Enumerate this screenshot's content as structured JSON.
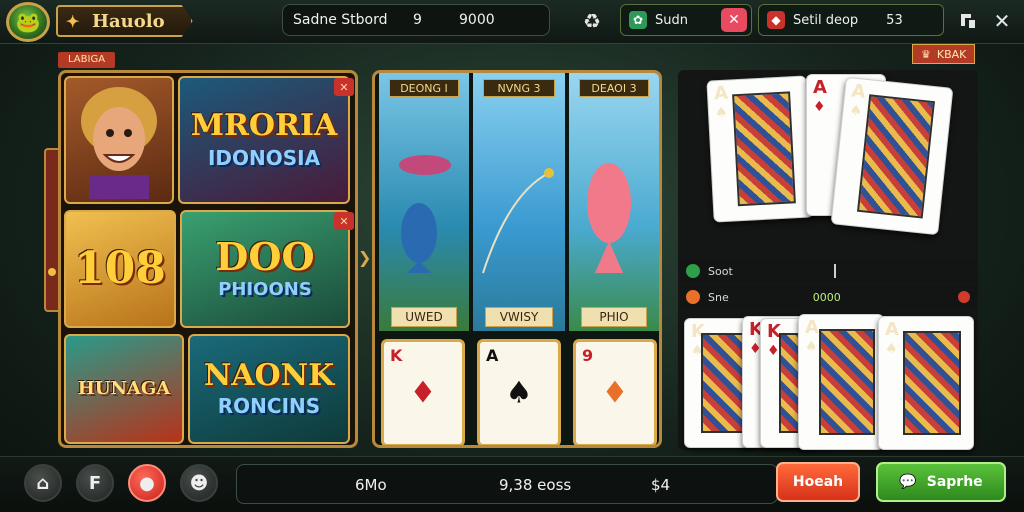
{
  "header": {
    "logo_icon": "frog-mascot-icon",
    "title": "Hauolo",
    "info_left": "Sadne Stbord",
    "info_mid": "9",
    "info_right": "9000",
    "recycle_icon": "recycle-icon",
    "pill1_label": "Sudn",
    "pill2_label": "Setil deop",
    "pill2_value": "53",
    "colors": {
      "accent_gold": "#c9a24a",
      "alert_red": "#e84a5f"
    }
  },
  "left_panel": {
    "label": "LABIGA",
    "tiles": [
      {
        "title": "MRORIA",
        "subtitle": "IDONOSIA"
      },
      {
        "title": "108"
      },
      {
        "title": "DOO",
        "subtitle": "PHIOONS"
      },
      {
        "title": "HUNAGA"
      },
      {
        "title": "NAONK",
        "subtitle": "RONCINS"
      }
    ]
  },
  "slots": {
    "reels": [
      {
        "label": "DEONG I",
        "bottom": "UWED"
      },
      {
        "label": "NVNG 3",
        "bottom": "VWISY"
      },
      {
        "label": "DEAOI 3",
        "bottom": "PHIO"
      }
    ],
    "cards": [
      {
        "rank": "K",
        "pip": "♦"
      },
      {
        "rank": "A",
        "pip": "♠"
      },
      {
        "rank": "9",
        "pip": "♦"
      }
    ]
  },
  "right_panel": {
    "badge": "KBAK",
    "top_cards": [
      {
        "rank": "A",
        "suit": "♠"
      },
      {
        "rank": "A",
        "suit": "♦"
      },
      {
        "rank": "A",
        "suit": "♠"
      }
    ],
    "status": [
      {
        "label": "Soot",
        "value": ""
      },
      {
        "label": "Sne",
        "value": "0000"
      }
    ],
    "bottom_cards": [
      {
        "rank": "K",
        "suit": "♠"
      },
      {
        "rank": "K",
        "suit": "♦"
      },
      {
        "rank": "K",
        "suit": "♦"
      },
      {
        "rank": "A",
        "suit": "♠"
      },
      {
        "rank": "A",
        "suit": "♠"
      }
    ]
  },
  "footer": {
    "info_left": "6Mo",
    "info_mid": "9,38 eoss",
    "info_right": "$4",
    "red_button": "Hoeah",
    "green_button": "Saprhe"
  }
}
